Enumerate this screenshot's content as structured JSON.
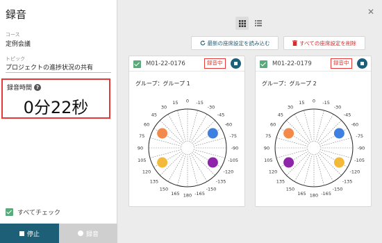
{
  "sidebar": {
    "title": "録音",
    "course_label": "コース",
    "course_value": "定例会議",
    "topic_label": "トピック",
    "topic_value": "プロジェクトの進捗状況の共有",
    "rec_time_label": "録音時間",
    "help_glyph": "?",
    "rec_time_value": "0分22秒",
    "check_all_label": "すべてチェック",
    "stop_label": "停止",
    "record_label": "録音"
  },
  "toolbar": {
    "reload_label": "最新の座席設定を読み込む",
    "delete_label": "すべての座席設定を削除"
  },
  "cards": [
    {
      "id": "M01-22-0176",
      "status": "録音中",
      "group": "グループ：グループ 1",
      "seats": [
        {
          "color": "#f48a4a",
          "angle": 60
        },
        {
          "color": "#3f7fe0",
          "angle": -60
        },
        {
          "color": "#f2b93b",
          "angle": 120
        },
        {
          "color": "#8e24aa",
          "angle": -120
        }
      ]
    },
    {
      "id": "M01-22-0179",
      "status": "録音中",
      "group": "グループ：グループ 2",
      "seats": [
        {
          "color": "#f48a4a",
          "angle": 60
        },
        {
          "color": "#3f7fe0",
          "angle": -60
        },
        {
          "color": "#8e24aa",
          "angle": 120
        },
        {
          "color": "#f2b93b",
          "angle": -120
        }
      ]
    }
  ],
  "dial_labels": [
    "0",
    "15",
    "30",
    "45",
    "60",
    "75",
    "90",
    "105",
    "120",
    "135",
    "150",
    "165",
    "180",
    "-165",
    "-150",
    "-135",
    "-120",
    "-105",
    "-90",
    "-75",
    "-60",
    "-45",
    "-30",
    "-15"
  ],
  "colors": {
    "accent": "#1e5f78",
    "alert": "#e53935",
    "check": "#5aaa7c"
  }
}
